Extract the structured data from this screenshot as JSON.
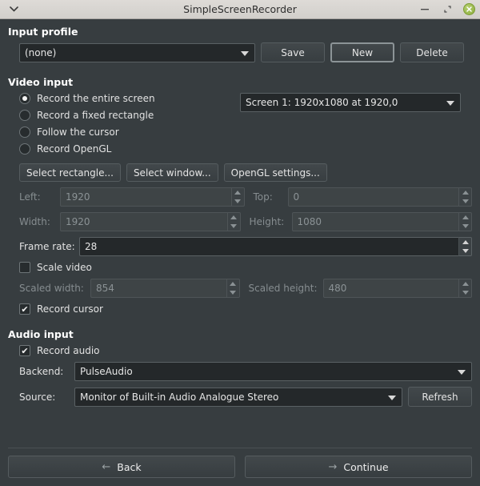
{
  "window": {
    "title": "SimpleScreenRecorder",
    "menu_icon": "chevron-down-icon",
    "minimize_label": "–",
    "maximize_label": "⬚",
    "close_label": "✕"
  },
  "input_profile": {
    "heading": "Input profile",
    "combo_value": "(none)",
    "save_label": "Save",
    "new_label": "New",
    "delete_label": "Delete"
  },
  "video_input": {
    "heading": "Video input",
    "options": [
      {
        "label": "Record the entire screen",
        "selected": true
      },
      {
        "label": "Record a fixed rectangle",
        "selected": false
      },
      {
        "label": "Follow the cursor",
        "selected": false
      },
      {
        "label": "Record OpenGL",
        "selected": false
      }
    ],
    "screen_combo_value": "Screen 1: 1920x1080 at 1920,0",
    "select_rectangle_label": "Select rectangle...",
    "select_window_label": "Select window...",
    "opengl_settings_label": "OpenGL settings...",
    "left_label": "Left:",
    "left_value": "1920",
    "top_label": "Top:",
    "top_value": "0",
    "width_label": "Width:",
    "width_value": "1920",
    "height_label": "Height:",
    "height_value": "1080",
    "frame_rate_label": "Frame rate:",
    "frame_rate_value": "28",
    "scale_video_label": "Scale video",
    "scale_video_checked": false,
    "scaled_width_label": "Scaled width:",
    "scaled_width_value": "854",
    "scaled_height_label": "Scaled height:",
    "scaled_height_value": "480",
    "record_cursor_label": "Record cursor",
    "record_cursor_checked": true
  },
  "audio_input": {
    "heading": "Audio input",
    "record_audio_label": "Record audio",
    "record_audio_checked": true,
    "backend_label": "Backend:",
    "backend_value": "PulseAudio",
    "source_label": "Source:",
    "source_value": "Monitor of Built-in Audio Analogue Stereo",
    "refresh_label": "Refresh"
  },
  "footer": {
    "back_label": "Back",
    "back_arrow": "←",
    "continue_label": "Continue",
    "continue_arrow": "→"
  },
  "check_glyph": "✔"
}
